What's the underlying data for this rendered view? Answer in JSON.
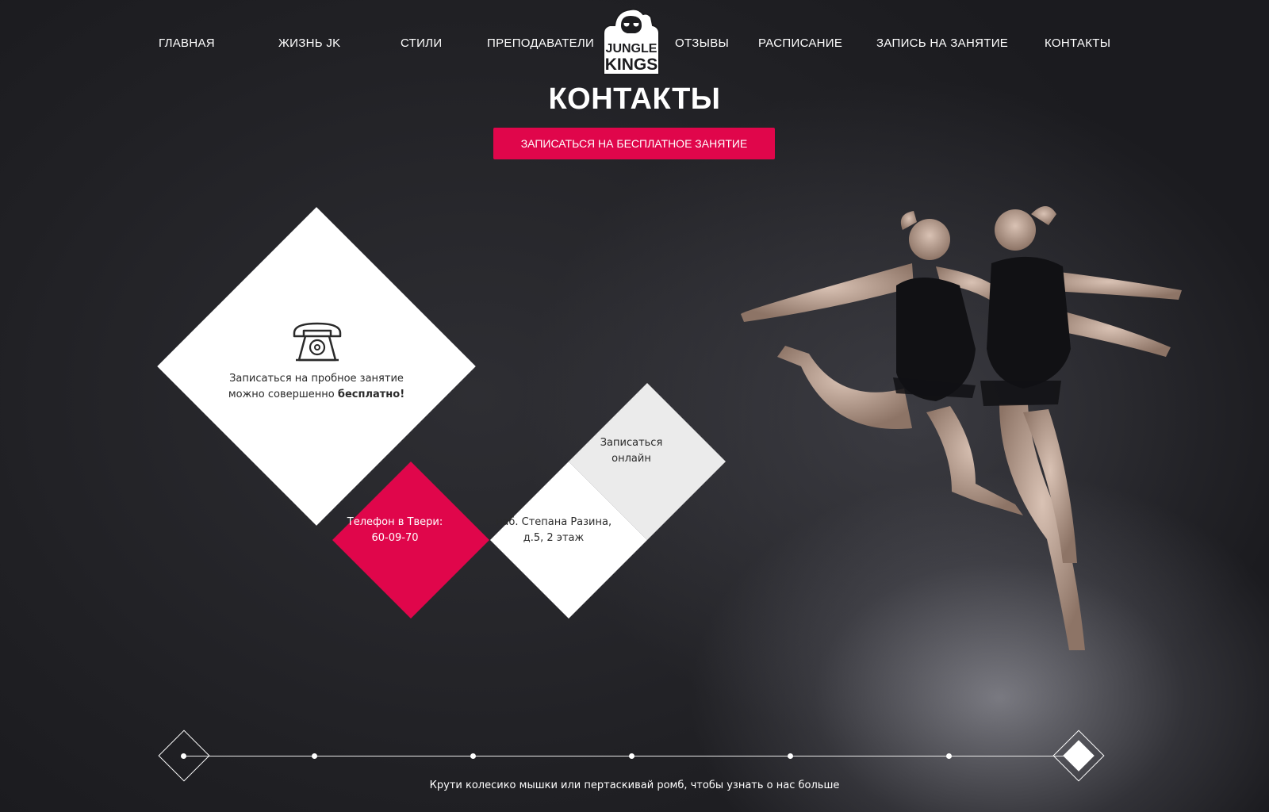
{
  "nav": {
    "items": [
      {
        "label": "ГЛАВНАЯ"
      },
      {
        "label": "ЖИЗНЬ JK"
      },
      {
        "label": "СТИЛИ"
      },
      {
        "label": "ПРЕПОДАВАТЕЛИ"
      },
      {
        "label": "ОТЗЫВЫ"
      },
      {
        "label": "РАСПИСАНИЕ"
      },
      {
        "label": "ЗАПИСЬ НА ЗАНЯТИЕ"
      },
      {
        "label": "КОНТАКТЫ"
      }
    ],
    "logo": {
      "line1": "JUNGLE",
      "line2": "KINGS"
    }
  },
  "header": {
    "title": "КОНТАКТЫ",
    "cta_label": "ЗАПИСАТЬСЯ НА БЕСПЛАТНОЕ ЗАНЯТИЕ"
  },
  "contacts": {
    "trial": {
      "line1": "Записаться на пробное занятие",
      "line2_prefix": "можно совершенно ",
      "line2_bold": "бесплатно!"
    },
    "phone": {
      "label": "Телефон в Твери:",
      "number": "60-09-70"
    },
    "address": {
      "line1": "наб. Степана Разина,",
      "line2": "д.5, 2 этаж"
    },
    "online": {
      "line1": "Записаться",
      "line2": "онлайн"
    }
  },
  "footer": {
    "hint": "Крути колесико мышки или пертаскивай ромб, чтобы узнать о нас больше"
  },
  "colors": {
    "accent": "#e0064b",
    "background": "#222226",
    "light_grey": "#ebebeb"
  },
  "icons": {
    "phone": "rotary-telephone-icon"
  }
}
